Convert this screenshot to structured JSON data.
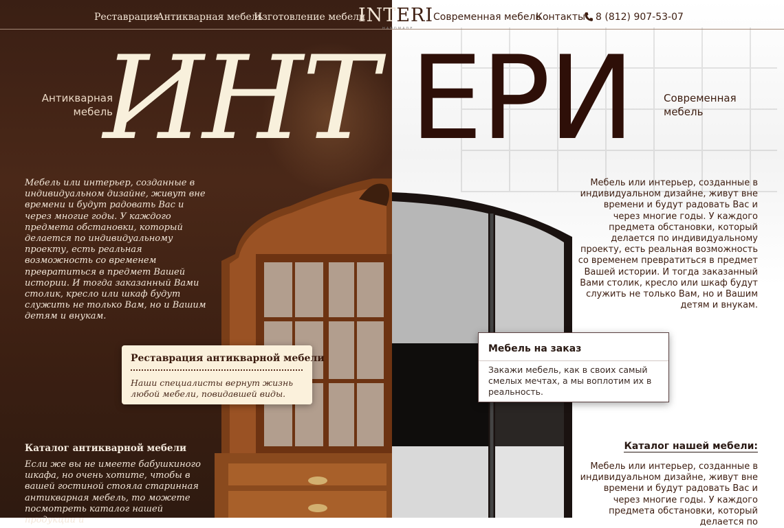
{
  "nav": {
    "left_links": [
      "Реставрация",
      "Антикварная мебель",
      "Изготовление мебели"
    ],
    "logo_a": "INT",
    "logo_b": "ERI",
    "logo_sub": "HANDMADE",
    "right_links": [
      "Современная мебель",
      "Контакты"
    ],
    "phone": "8 (812) 907-53-07"
  },
  "hero": {
    "title_left": "ИНТ",
    "title_right": "ЕРИ",
    "subtitle_left": "Антикварная мебель",
    "subtitle_right": "Современная мебель"
  },
  "left": {
    "intro": "Мебель или интерьер, созданные в индивидуальном дизайне, живут вне времени и будут радовать Вас и через многие годы. У каждого предмета обстановки, который делается по индивидуальному проекту, есть реальная возможность со временем превратиться в предмет Вашей истории. И тогда заказанный Вами столик, кресло или шкаф будут служить не только Вам, но и Вашим детям и внукам.",
    "card_title": "Реставрация антикварной мебели",
    "card_text": "Наши специалисты вернут жизнь любой мебели, повидавшей виды.",
    "catalog_title": "Каталог антикварной мебели",
    "catalog_text": "Если же вы не имеете бабушкиного шкафа, но очень хотите, чтобы в вашей гостиной стояла старинная антикварная мебель, то можете посмотреть каталог нашей продукции и"
  },
  "right": {
    "intro": "Мебель или интерьер, созданные в индивидуальном дизайне, живут вне времени и будут радовать Вас и через многие годы. У каждого предмета обстановки, который делается по индивидуальному проекту, есть реальная возможность со временем превратиться в предмет Вашей истории. И тогда заказанный Вами столик, кресло или шкаф будут служить не только Вам, но и Вашим детям и внукам.",
    "card_title": "Мебель на заказ",
    "card_text": "Закажи мебель, как в своих самый смелых мечтах, а мы воплотим их в реальность.",
    "catalog_title": "Каталог нашей мебели:",
    "catalog_text": "Мебель или интерьер, созданные в индивидуальном дизайне, живут вне времени и будут радовать Вас и через многие годы. У каждого предмета обстановки, который делается по"
  },
  "colors": {
    "dark_brown": "#3a1f14",
    "cream": "#f8f0dc",
    "title_dark": "#2e0f08"
  }
}
